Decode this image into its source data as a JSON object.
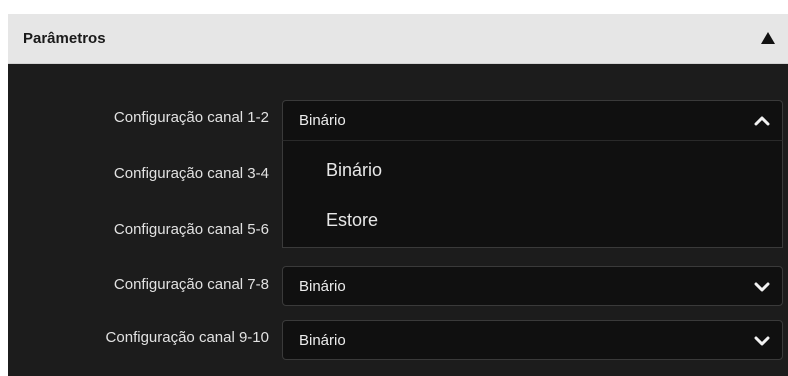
{
  "panel": {
    "title": "Parâmetros",
    "collapse_icon": "triangle-up-icon"
  },
  "rows": [
    {
      "label": "Configuração canal 1-2",
      "value": "Binário",
      "state": "open",
      "chevron": "chevron-up-icon"
    },
    {
      "label": "Configuração canal 3-4",
      "value": "",
      "state": "covered"
    },
    {
      "label": "Configuração canal 5-6",
      "value": "",
      "state": "covered"
    },
    {
      "label": "Configuração canal 7-8",
      "value": "Binário",
      "state": "closed",
      "chevron": "chevron-down-icon"
    },
    {
      "label": "Configuração canal 9-10",
      "value": "Binário",
      "state": "closed",
      "chevron": "chevron-down-icon"
    }
  ],
  "dropdown": {
    "options": [
      "Binário",
      "Estore"
    ]
  },
  "colors": {
    "panel_bg": "#1c1c1c",
    "header_bg": "#e6e6e6",
    "select_bg": "#101010",
    "text": "#e2e2e2"
  }
}
